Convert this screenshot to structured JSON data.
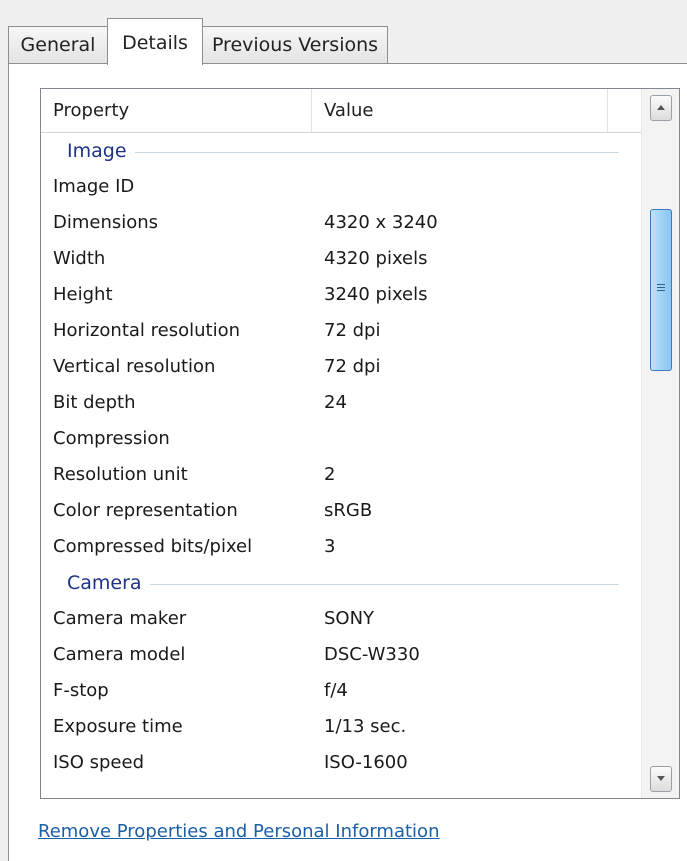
{
  "tabs": [
    {
      "label": "General"
    },
    {
      "label": "Details"
    },
    {
      "label": "Previous Versions"
    }
  ],
  "columns": {
    "property": "Property",
    "value": "Value"
  },
  "groups": [
    {
      "title": "Image",
      "rows": [
        {
          "property": "Image ID",
          "value": ""
        },
        {
          "property": "Dimensions",
          "value": "4320 x 3240"
        },
        {
          "property": "Width",
          "value": "4320 pixels"
        },
        {
          "property": "Height",
          "value": "3240 pixels"
        },
        {
          "property": "Horizontal resolution",
          "value": "72 dpi"
        },
        {
          "property": "Vertical resolution",
          "value": "72 dpi"
        },
        {
          "property": "Bit depth",
          "value": "24"
        },
        {
          "property": "Compression",
          "value": ""
        },
        {
          "property": "Resolution unit",
          "value": "2"
        },
        {
          "property": "Color representation",
          "value": "sRGB"
        },
        {
          "property": "Compressed bits/pixel",
          "value": "3"
        }
      ]
    },
    {
      "title": "Camera",
      "rows": [
        {
          "property": "Camera maker",
          "value": "SONY"
        },
        {
          "property": "Camera model",
          "value": "DSC-W330"
        },
        {
          "property": "F-stop",
          "value": "f/4"
        },
        {
          "property": "Exposure time",
          "value": "1/13 sec."
        },
        {
          "property": "ISO speed",
          "value": "ISO-1600"
        }
      ]
    }
  ],
  "scrollbar": {
    "position": 0.18
  },
  "footer": {
    "link": "Remove Properties and Personal Information"
  }
}
